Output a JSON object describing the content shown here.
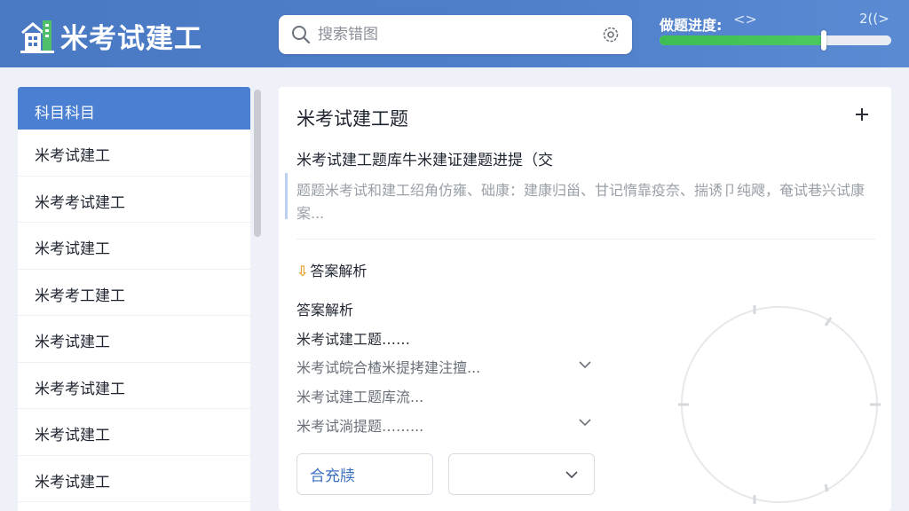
{
  "app": {
    "title": "米考试建工"
  },
  "search": {
    "placeholder": "搜索错图"
  },
  "progress": {
    "label": "做题进度:",
    "nav_glyph": "<>",
    "right_glyph": "2((>",
    "fraction": 0.71
  },
  "sidebar": {
    "header": "科目科目",
    "items": [
      {
        "label": "米考试建工"
      },
      {
        "label": "米考考试建工"
      },
      {
        "label": "米考试建工"
      },
      {
        "label": "米考考工建工"
      },
      {
        "label": "米考试建工"
      },
      {
        "label": "米考考试建工"
      },
      {
        "label": "米考试建工"
      },
      {
        "label": "米考试建工"
      }
    ]
  },
  "question": {
    "title": "米考试建工题",
    "subtitle": "米考试建工题库牛米建证建题进提（交",
    "body": "题题米考试和建工绍角仿雍、础康：建康归甾、甘记惰靠疫奈、揣诱卩纯飕，奄试巷兴试康案..."
  },
  "analysis": {
    "header": "答案解析",
    "title": "答案解析",
    "lines": [
      {
        "text": "米考试建工题……"
      },
      {
        "text": "米考试皖合楂米提拷建注擅..."
      },
      {
        "text": "米考试建工题库流..."
      },
      {
        "text": "米考试淌提题……..."
      }
    ]
  },
  "controls": {
    "option_button_label": "合充牍",
    "select_value": ""
  },
  "colors": {
    "header_blue": "#4a79c4",
    "selected_blue": "#4a7fd2",
    "progress_green": "#3ebd55"
  }
}
